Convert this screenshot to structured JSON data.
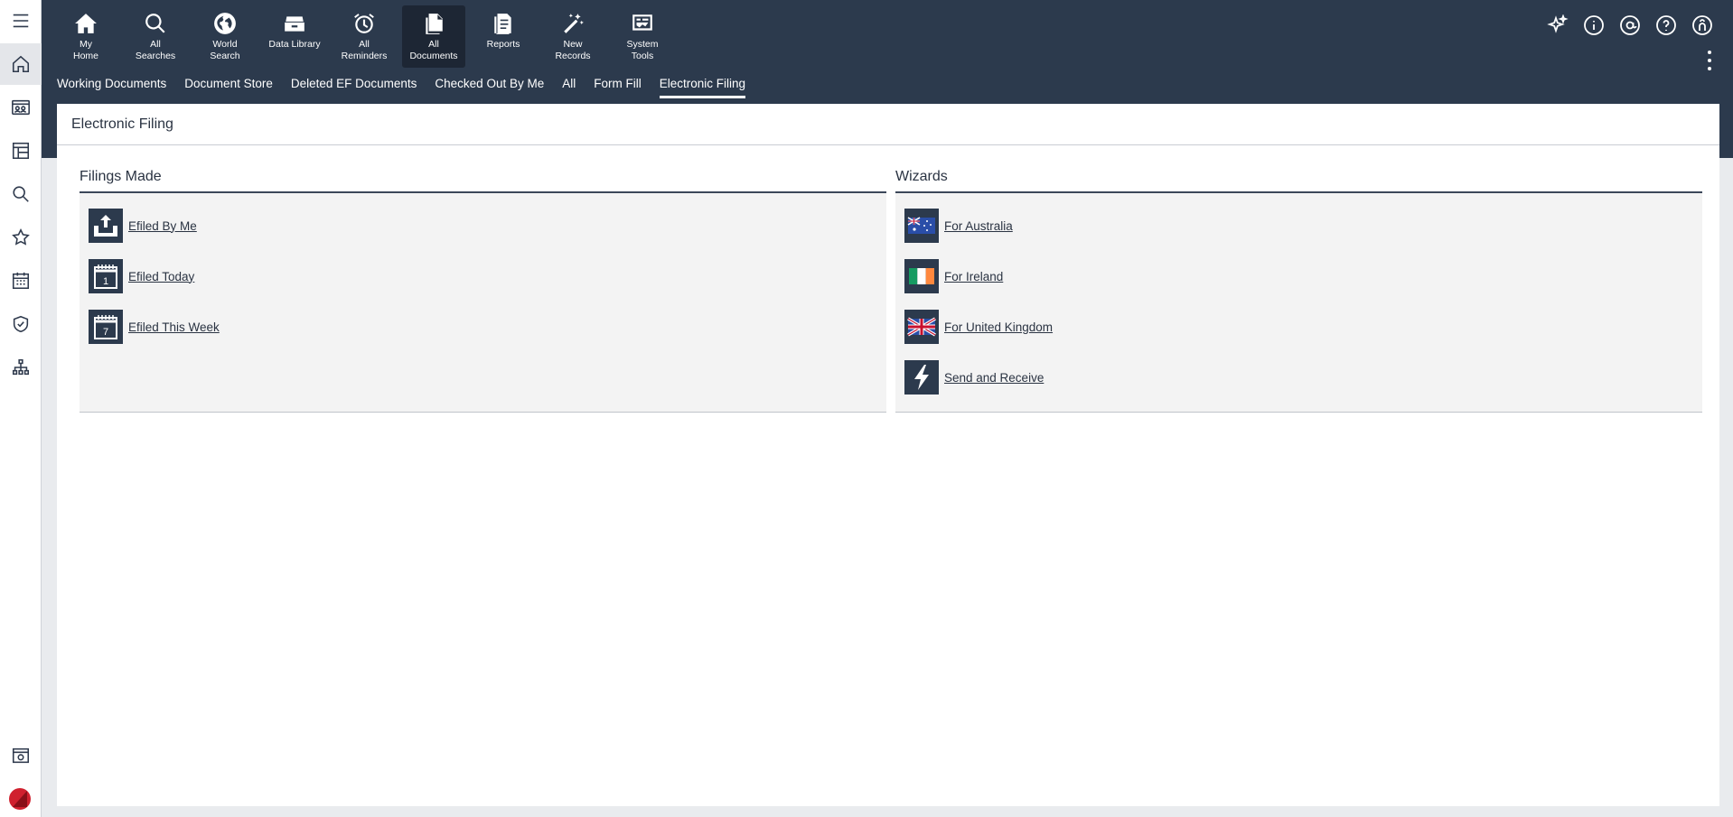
{
  "toolbar": {
    "items": [
      {
        "label": "My\nHome",
        "icon": "home-icon"
      },
      {
        "label": "All\nSearches",
        "icon": "search-icon"
      },
      {
        "label": "World\nSearch",
        "icon": "globe-icon"
      },
      {
        "label": "Data Library",
        "icon": "drawer-icon"
      },
      {
        "label": "All\nReminders",
        "icon": "alarm-clock-icon"
      },
      {
        "label": "All\nDocuments",
        "icon": "documents-icon"
      },
      {
        "label": "Reports",
        "icon": "report-icon"
      },
      {
        "label": "New\nRecords",
        "icon": "magic-wand-icon"
      },
      {
        "label": "System\nTools",
        "icon": "system-tools-icon"
      }
    ],
    "active_index": 5
  },
  "tabs": [
    "Working Documents",
    "Document Store",
    "Deleted EF Documents",
    "Checked Out By Me",
    "All",
    "Form Fill",
    "Electronic Filing"
  ],
  "active_tab": "Electronic Filing",
  "page": {
    "title": "Electronic Filing"
  },
  "filings": {
    "title": "Filings Made",
    "links": [
      "Efiled By Me",
      "Efiled Today",
      "Efiled This Week"
    ]
  },
  "wizards": {
    "title": "Wizards",
    "links": [
      "For Australia",
      "For Ireland",
      "For United Kingdom",
      "Send and Receive"
    ]
  },
  "colors": {
    "header_bg": "#2c3a4d",
    "active_tool_bg": "#1d2634",
    "panel_bg": "#f3f3f3",
    "brand_red": "#d0202e"
  }
}
